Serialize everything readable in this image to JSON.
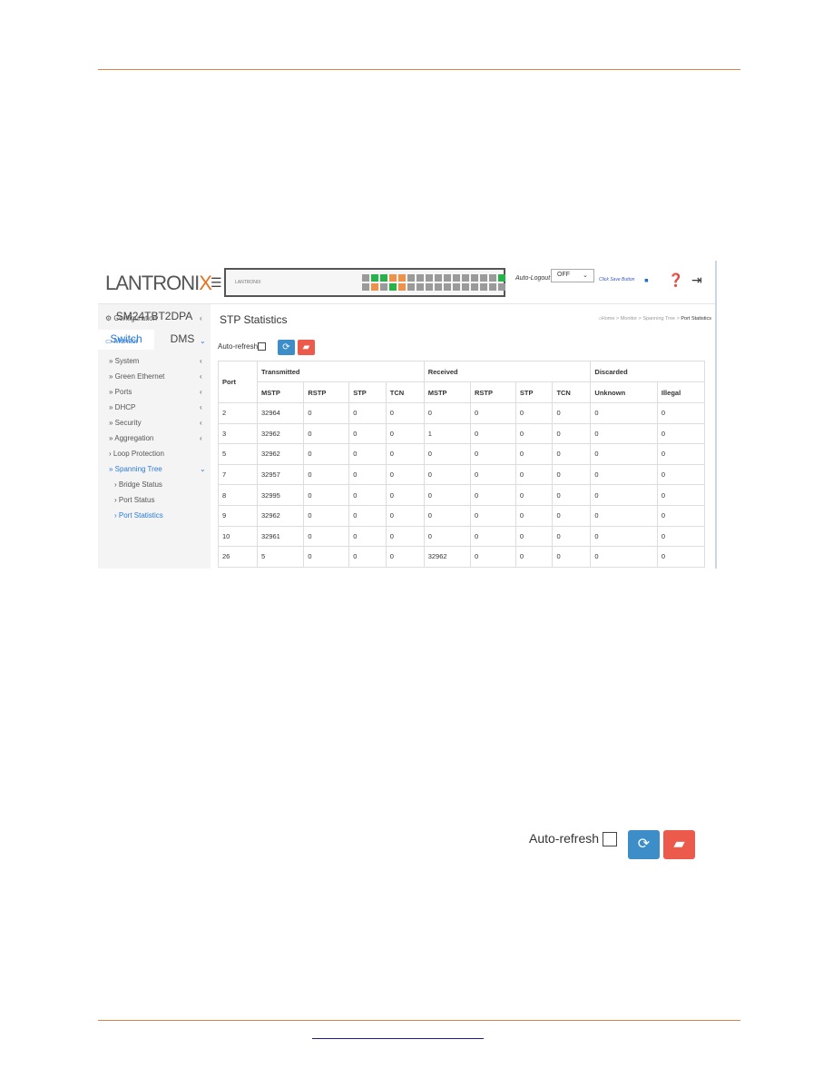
{
  "header": {
    "logo": "LANTRONIX",
    "panel_logo": "LANTRONIX",
    "auto_logout_label": "Auto-Logout",
    "auto_logout_value": "OFF",
    "click_save": "Click Save Button"
  },
  "sidebar": {
    "device": "SM24TBT2DPA",
    "tabs": [
      "Switch",
      "DMS"
    ],
    "items": [
      {
        "label": "Configuration",
        "icon": "gear-icon"
      },
      {
        "label": "Monitor",
        "icon": "laptop-icon"
      },
      {
        "label": "» System"
      },
      {
        "label": "» Green Ethernet"
      },
      {
        "label": "» Ports"
      },
      {
        "label": "» DHCP"
      },
      {
        "label": "» Security"
      },
      {
        "label": "» Aggregation"
      },
      {
        "label": "› Loop Protection"
      },
      {
        "label": "» Spanning Tree"
      },
      {
        "label": "› Bridge Status"
      },
      {
        "label": "› Port Status"
      },
      {
        "label": "› Port Statistics"
      }
    ]
  },
  "main": {
    "title": "STP Statistics",
    "breadcrumb": [
      "Home",
      "Monitor",
      "Spanning Tree",
      "Port Statistics"
    ],
    "auto_refresh": "Auto-refresh",
    "table": {
      "groups": [
        "Transmitted",
        "Received",
        "Discarded"
      ],
      "port_header": "Port",
      "columns": [
        "MSTP",
        "RSTP",
        "STP",
        "TCN",
        "MSTP",
        "RSTP",
        "STP",
        "TCN",
        "Unknown",
        "Illegal"
      ],
      "rows": [
        [
          "2",
          "32964",
          "0",
          "0",
          "0",
          "0",
          "0",
          "0",
          "0",
          "0",
          "0"
        ],
        [
          "3",
          "32962",
          "0",
          "0",
          "0",
          "1",
          "0",
          "0",
          "0",
          "0",
          "0"
        ],
        [
          "5",
          "32962",
          "0",
          "0",
          "0",
          "0",
          "0",
          "0",
          "0",
          "0",
          "0"
        ],
        [
          "7",
          "32957",
          "0",
          "0",
          "0",
          "0",
          "0",
          "0",
          "0",
          "0",
          "0"
        ],
        [
          "8",
          "32995",
          "0",
          "0",
          "0",
          "0",
          "0",
          "0",
          "0",
          "0",
          "0"
        ],
        [
          "9",
          "32962",
          "0",
          "0",
          "0",
          "0",
          "0",
          "0",
          "0",
          "0",
          "0"
        ],
        [
          "10",
          "32961",
          "0",
          "0",
          "0",
          "0",
          "0",
          "0",
          "0",
          "0",
          "0"
        ],
        [
          "26",
          "5",
          "0",
          "0",
          "0",
          "32962",
          "0",
          "0",
          "0",
          "0",
          "0"
        ]
      ]
    }
  },
  "detail": {
    "auto_refresh": "Auto-refresh"
  },
  "colors": {
    "accent_rule": "#d9834a",
    "refresh_button": "#3d8dc8",
    "clear_button": "#ec5a4c",
    "active_link": "#2b7bd6"
  }
}
